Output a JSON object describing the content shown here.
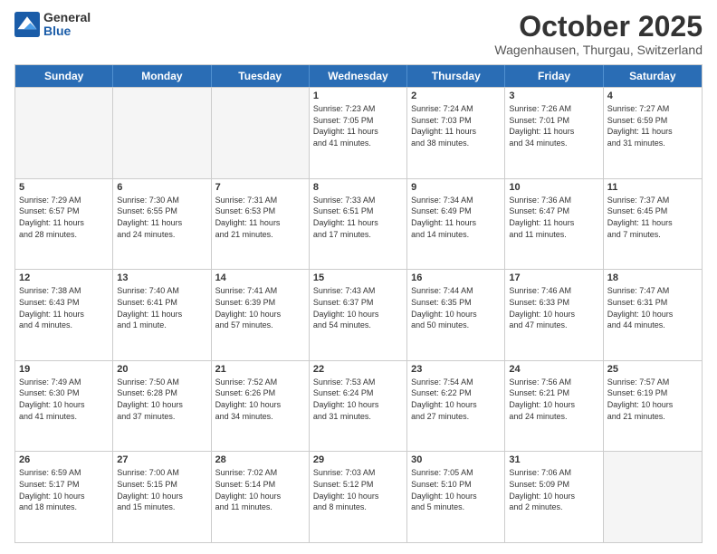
{
  "header": {
    "logo": {
      "general": "General",
      "blue": "Blue"
    },
    "title": "October 2025",
    "location": "Wagenhausen, Thurgau, Switzerland"
  },
  "weekdays": [
    "Sunday",
    "Monday",
    "Tuesday",
    "Wednesday",
    "Thursday",
    "Friday",
    "Saturday"
  ],
  "rows": [
    [
      {
        "num": "",
        "info": "",
        "empty": true
      },
      {
        "num": "",
        "info": "",
        "empty": true
      },
      {
        "num": "",
        "info": "",
        "empty": true
      },
      {
        "num": "1",
        "info": "Sunrise: 7:23 AM\nSunset: 7:05 PM\nDaylight: 11 hours\nand 41 minutes.",
        "empty": false
      },
      {
        "num": "2",
        "info": "Sunrise: 7:24 AM\nSunset: 7:03 PM\nDaylight: 11 hours\nand 38 minutes.",
        "empty": false
      },
      {
        "num": "3",
        "info": "Sunrise: 7:26 AM\nSunset: 7:01 PM\nDaylight: 11 hours\nand 34 minutes.",
        "empty": false
      },
      {
        "num": "4",
        "info": "Sunrise: 7:27 AM\nSunset: 6:59 PM\nDaylight: 11 hours\nand 31 minutes.",
        "empty": false
      }
    ],
    [
      {
        "num": "5",
        "info": "Sunrise: 7:29 AM\nSunset: 6:57 PM\nDaylight: 11 hours\nand 28 minutes.",
        "empty": false
      },
      {
        "num": "6",
        "info": "Sunrise: 7:30 AM\nSunset: 6:55 PM\nDaylight: 11 hours\nand 24 minutes.",
        "empty": false
      },
      {
        "num": "7",
        "info": "Sunrise: 7:31 AM\nSunset: 6:53 PM\nDaylight: 11 hours\nand 21 minutes.",
        "empty": false
      },
      {
        "num": "8",
        "info": "Sunrise: 7:33 AM\nSunset: 6:51 PM\nDaylight: 11 hours\nand 17 minutes.",
        "empty": false
      },
      {
        "num": "9",
        "info": "Sunrise: 7:34 AM\nSunset: 6:49 PM\nDaylight: 11 hours\nand 14 minutes.",
        "empty": false
      },
      {
        "num": "10",
        "info": "Sunrise: 7:36 AM\nSunset: 6:47 PM\nDaylight: 11 hours\nand 11 minutes.",
        "empty": false
      },
      {
        "num": "11",
        "info": "Sunrise: 7:37 AM\nSunset: 6:45 PM\nDaylight: 11 hours\nand 7 minutes.",
        "empty": false
      }
    ],
    [
      {
        "num": "12",
        "info": "Sunrise: 7:38 AM\nSunset: 6:43 PM\nDaylight: 11 hours\nand 4 minutes.",
        "empty": false
      },
      {
        "num": "13",
        "info": "Sunrise: 7:40 AM\nSunset: 6:41 PM\nDaylight: 11 hours\nand 1 minute.",
        "empty": false
      },
      {
        "num": "14",
        "info": "Sunrise: 7:41 AM\nSunset: 6:39 PM\nDaylight: 10 hours\nand 57 minutes.",
        "empty": false
      },
      {
        "num": "15",
        "info": "Sunrise: 7:43 AM\nSunset: 6:37 PM\nDaylight: 10 hours\nand 54 minutes.",
        "empty": false
      },
      {
        "num": "16",
        "info": "Sunrise: 7:44 AM\nSunset: 6:35 PM\nDaylight: 10 hours\nand 50 minutes.",
        "empty": false
      },
      {
        "num": "17",
        "info": "Sunrise: 7:46 AM\nSunset: 6:33 PM\nDaylight: 10 hours\nand 47 minutes.",
        "empty": false
      },
      {
        "num": "18",
        "info": "Sunrise: 7:47 AM\nSunset: 6:31 PM\nDaylight: 10 hours\nand 44 minutes.",
        "empty": false
      }
    ],
    [
      {
        "num": "19",
        "info": "Sunrise: 7:49 AM\nSunset: 6:30 PM\nDaylight: 10 hours\nand 41 minutes.",
        "empty": false
      },
      {
        "num": "20",
        "info": "Sunrise: 7:50 AM\nSunset: 6:28 PM\nDaylight: 10 hours\nand 37 minutes.",
        "empty": false
      },
      {
        "num": "21",
        "info": "Sunrise: 7:52 AM\nSunset: 6:26 PM\nDaylight: 10 hours\nand 34 minutes.",
        "empty": false
      },
      {
        "num": "22",
        "info": "Sunrise: 7:53 AM\nSunset: 6:24 PM\nDaylight: 10 hours\nand 31 minutes.",
        "empty": false
      },
      {
        "num": "23",
        "info": "Sunrise: 7:54 AM\nSunset: 6:22 PM\nDaylight: 10 hours\nand 27 minutes.",
        "empty": false
      },
      {
        "num": "24",
        "info": "Sunrise: 7:56 AM\nSunset: 6:21 PM\nDaylight: 10 hours\nand 24 minutes.",
        "empty": false
      },
      {
        "num": "25",
        "info": "Sunrise: 7:57 AM\nSunset: 6:19 PM\nDaylight: 10 hours\nand 21 minutes.",
        "empty": false
      }
    ],
    [
      {
        "num": "26",
        "info": "Sunrise: 6:59 AM\nSunset: 5:17 PM\nDaylight: 10 hours\nand 18 minutes.",
        "empty": false
      },
      {
        "num": "27",
        "info": "Sunrise: 7:00 AM\nSunset: 5:15 PM\nDaylight: 10 hours\nand 15 minutes.",
        "empty": false
      },
      {
        "num": "28",
        "info": "Sunrise: 7:02 AM\nSunset: 5:14 PM\nDaylight: 10 hours\nand 11 minutes.",
        "empty": false
      },
      {
        "num": "29",
        "info": "Sunrise: 7:03 AM\nSunset: 5:12 PM\nDaylight: 10 hours\nand 8 minutes.",
        "empty": false
      },
      {
        "num": "30",
        "info": "Sunrise: 7:05 AM\nSunset: 5:10 PM\nDaylight: 10 hours\nand 5 minutes.",
        "empty": false
      },
      {
        "num": "31",
        "info": "Sunrise: 7:06 AM\nSunset: 5:09 PM\nDaylight: 10 hours\nand 2 minutes.",
        "empty": false
      },
      {
        "num": "",
        "info": "",
        "empty": true
      }
    ]
  ]
}
